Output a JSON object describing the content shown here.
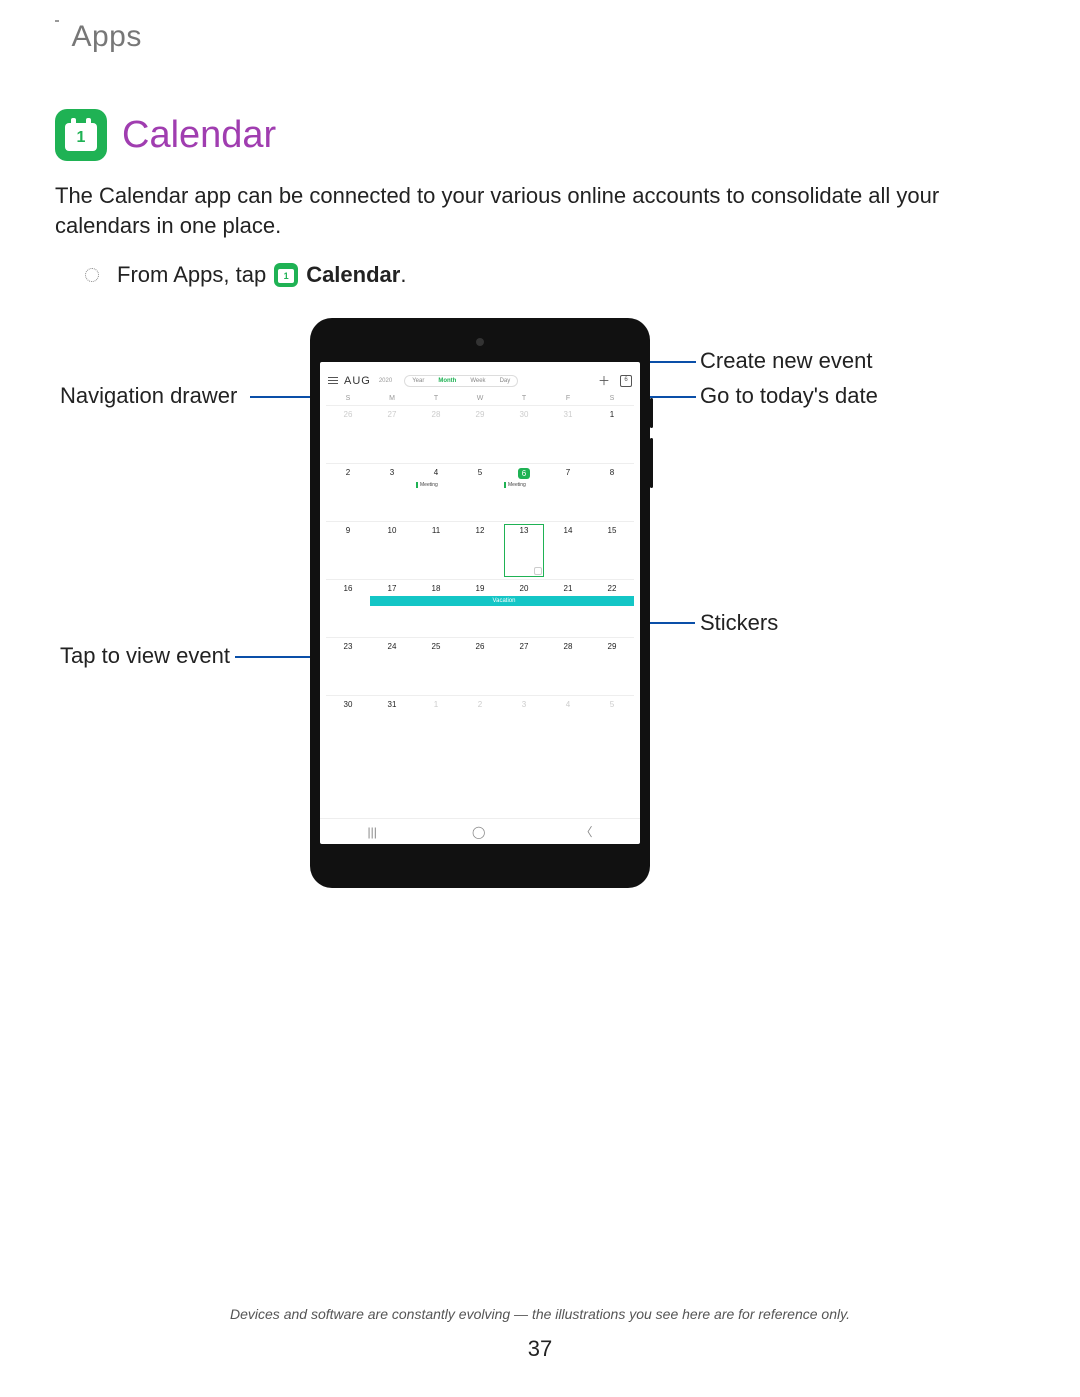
{
  "header": "Apps",
  "icon_num": "1",
  "title": "Calendar",
  "intro": "The Calendar app can be connected to your various online accounts to consolidate all your calendars in one place.",
  "step_prefix": "From Apps, tap",
  "step_bold": "Calendar",
  "step_suffix": ".",
  "callouts": {
    "nav_drawer": "Navigation drawer",
    "tap_event": "Tap to view event",
    "create_event": "Create new event",
    "today": "Go to today's date",
    "stickers": "Stickers"
  },
  "device": {
    "month": "AUG",
    "year": "2020",
    "views": [
      "Year",
      "Month",
      "Week",
      "Day"
    ],
    "active_view": "Month",
    "today_icon_num": "6",
    "dow": [
      "S",
      "M",
      "T",
      "W",
      "T",
      "F",
      "S"
    ],
    "weeks": [
      [
        {
          "n": "26",
          "out": true
        },
        {
          "n": "27",
          "out": true
        },
        {
          "n": "28",
          "out": true
        },
        {
          "n": "29",
          "out": true
        },
        {
          "n": "30",
          "out": true
        },
        {
          "n": "31",
          "out": true
        },
        {
          "n": "1"
        }
      ],
      [
        {
          "n": "2"
        },
        {
          "n": "3"
        },
        {
          "n": "4",
          "evt": "Meeting"
        },
        {
          "n": "5"
        },
        {
          "n": "6",
          "today": true,
          "evt": "Meeting"
        },
        {
          "n": "7"
        },
        {
          "n": "8"
        }
      ],
      [
        {
          "n": "9"
        },
        {
          "n": "10"
        },
        {
          "n": "11"
        },
        {
          "n": "12"
        },
        {
          "n": "13",
          "sel": true,
          "sticker": true
        },
        {
          "n": "14"
        },
        {
          "n": "15"
        }
      ],
      [
        {
          "n": "16"
        },
        {
          "n": "17"
        },
        {
          "n": "18"
        },
        {
          "n": "19"
        },
        {
          "n": "20"
        },
        {
          "n": "21"
        },
        {
          "n": "22"
        }
      ],
      [
        {
          "n": "23"
        },
        {
          "n": "24"
        },
        {
          "n": "25"
        },
        {
          "n": "26"
        },
        {
          "n": "27"
        },
        {
          "n": "28"
        },
        {
          "n": "29"
        }
      ],
      [
        {
          "n": "30"
        },
        {
          "n": "31"
        },
        {
          "n": "1",
          "out": true
        },
        {
          "n": "2",
          "out": true
        },
        {
          "n": "3",
          "out": true
        },
        {
          "n": "4",
          "out": true
        },
        {
          "n": "5",
          "out": true
        }
      ]
    ],
    "vacation_label": "Vacation"
  },
  "footnote": "Devices and software are constantly evolving — the illustrations you see here are for reference only.",
  "page_number": "37"
}
